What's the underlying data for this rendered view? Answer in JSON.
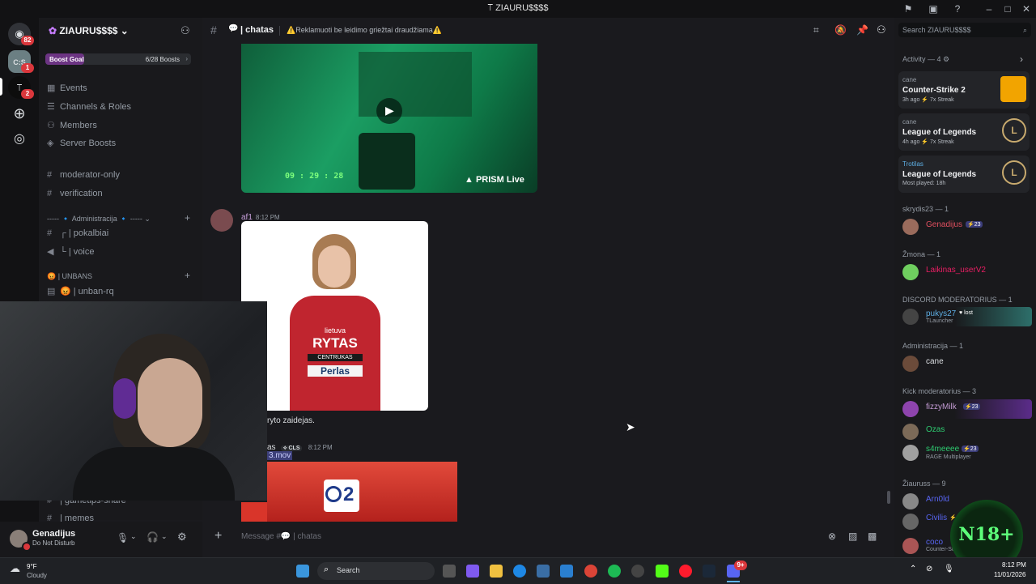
{
  "window": {
    "title": "ZIAURU$$$$"
  },
  "rail": {
    "home_badge": "82",
    "server1_badge": "1",
    "server2_badge": "2"
  },
  "sidebar": {
    "server_name": "ZIAURU$$$$",
    "boost_label": "Boost Goal",
    "boost_progress": "6/28 Boosts",
    "items": [
      {
        "label": "Events"
      },
      {
        "label": "Channels & Roles"
      },
      {
        "label": "Members"
      },
      {
        "label": "Server Boosts"
      }
    ],
    "channels": [
      {
        "label": "moderator-only"
      },
      {
        "label": "verification"
      }
    ],
    "category_admin": "----- 🔹 Administracija 🔹 -----",
    "admin_channels": [
      {
        "label": "┌ | pokalbiai"
      },
      {
        "label": "└ | voice"
      }
    ],
    "category_unbans": "😡 | UNBANS",
    "unban_channel": "😡 | unban-rq",
    "bottom_channels": [
      {
        "label": "| gametips-share"
      },
      {
        "label": "| memes"
      }
    ]
  },
  "user": {
    "name": "Genadijus",
    "status": "Do Not Disturb"
  },
  "chat": {
    "channel": "| chatas",
    "topic": "⚠️Reklamuoti be leidimo griežtai draudžiama⚠️",
    "video_timestamp": "09 : 29 : 28",
    "prism": "PRISM Live",
    "msg1_author": "af1",
    "msg1_time": "8:12 PM",
    "msg1_text": "ryto zaidejas.",
    "jersey": {
      "line1": "lietuva",
      "line2": "RYTAS",
      "line3": "CENTRUKAS",
      "line4": "Perlas"
    },
    "msg2_author": "as",
    "msg2_tag": "CLS",
    "msg2_time": "8:12 PM",
    "msg2_file": "3.mov",
    "cbs_number": "2",
    "composer_placeholder": "Message #💬 | chatas"
  },
  "members": {
    "search_placeholder": "Search ZIAURU$$$$",
    "activity_header": "Activity — 4",
    "activities": [
      {
        "user": "cane",
        "game": "Counter-Strike 2",
        "meta": "3h ago  ⚡ 7x Streak"
      },
      {
        "user": "cane",
        "game": "League of Legends",
        "meta": "4h ago  ⚡ 7x Streak"
      },
      {
        "user": "Trotilas",
        "game": "League of Legends",
        "meta": "Most played: 18h"
      }
    ],
    "groups": [
      {
        "title": "skrydis23 — 1",
        "members": [
          {
            "name": "Genadijus",
            "sub": "",
            "color": "#e04f5f",
            "tag": "23"
          }
        ]
      },
      {
        "title": "Žmona — 1",
        "members": [
          {
            "name": "Laikinas_userV2",
            "sub": "",
            "color": "#e91e63",
            "tag": ""
          }
        ]
      },
      {
        "title": "DISCORD MODERATORIUS — 1",
        "members": [
          {
            "name": "pukys27",
            "sub": "TLauncher",
            "color": "#5dade2",
            "tag": "lost"
          }
        ]
      },
      {
        "title": "Administracija — 1",
        "members": [
          {
            "name": "cane",
            "sub": "",
            "color": "#dbdee1",
            "tag": ""
          }
        ]
      },
      {
        "title": "Kick moderatorius — 3",
        "members": [
          {
            "name": "fizzyMilk",
            "sub": "",
            "color": "#9b59b6",
            "tag": "23"
          },
          {
            "name": "Ozas",
            "sub": "",
            "color": "#2ecc71",
            "tag": ""
          },
          {
            "name": "s4meeee",
            "sub": "RAGE Multiplayer",
            "color": "#2ecc71",
            "tag": "23"
          }
        ]
      },
      {
        "title": "Žiauruss — 9",
        "members": [
          {
            "name": "Arn0ld",
            "sub": "",
            "color": "#5865f2",
            "tag": ""
          },
          {
            "name": "Civilis",
            "sub": "",
            "color": "#5865f2",
            "tag": "120"
          },
          {
            "name": "coco",
            "sub": "Counter-Strike 2",
            "color": "#5865f2",
            "tag": ""
          }
        ]
      }
    ]
  },
  "overlay": {
    "n18": "N18+"
  },
  "taskbar": {
    "weather_temp": "9°F",
    "weather_desc": "Cloudy",
    "search": "Search",
    "time": "8:12 PM",
    "date": "11/01/2026",
    "steam_badge": "9+"
  },
  "colors": {
    "accent": "#5865f2",
    "dnd": "#da373c",
    "online": "#23a55a"
  }
}
